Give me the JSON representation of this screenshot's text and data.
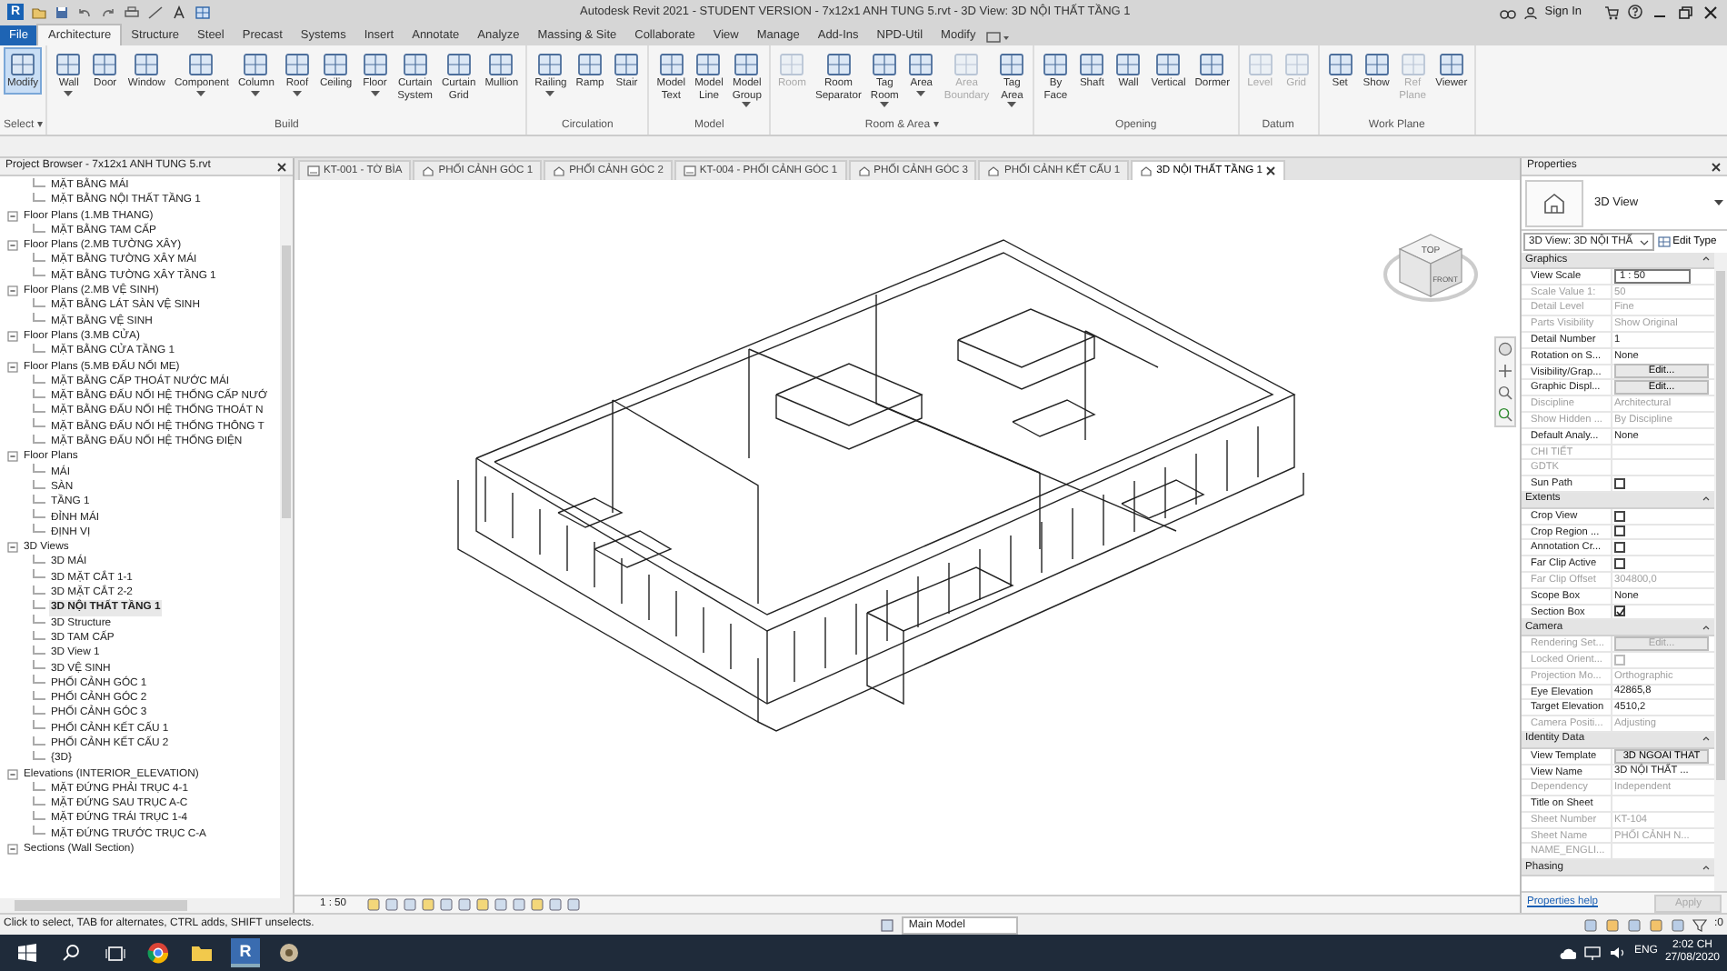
{
  "title_bar": {
    "logo": "R",
    "title": "Autodesk Revit 2021 - STUDENT VERSION - 7x12x1 ANH TUNG 5.rvt - 3D View: 3D NỘI THẤT TẦNG 1",
    "sign_in": "Sign In"
  },
  "ribbon_tabs": [
    {
      "label": "File",
      "kind": "file",
      "selected": false
    },
    {
      "label": "Architecture",
      "kind": "tab",
      "selected": true
    },
    {
      "label": "Structure",
      "kind": "tab",
      "selected": false
    },
    {
      "label": "Steel",
      "kind": "tab",
      "selected": false
    },
    {
      "label": "Precast",
      "kind": "tab",
      "selected": false
    },
    {
      "label": "Systems",
      "kind": "tab",
      "selected": false
    },
    {
      "label": "Insert",
      "kind": "tab",
      "selected": false
    },
    {
      "label": "Annotate",
      "kind": "tab",
      "selected": false
    },
    {
      "label": "Analyze",
      "kind": "tab",
      "selected": false
    },
    {
      "label": "Massing & Site",
      "kind": "tab",
      "selected": false
    },
    {
      "label": "Collaborate",
      "kind": "tab",
      "selected": false
    },
    {
      "label": "View",
      "kind": "tab",
      "selected": false
    },
    {
      "label": "Manage",
      "kind": "tab",
      "selected": false
    },
    {
      "label": "Add-Ins",
      "kind": "tab",
      "selected": false
    },
    {
      "label": "NPD-Util",
      "kind": "tab",
      "selected": false
    },
    {
      "label": "Modify",
      "kind": "tab",
      "selected": false
    }
  ],
  "ribbon_panels": [
    {
      "label": "Select ▾",
      "tools": [
        {
          "label": "Modify",
          "active": true,
          "disabled": false,
          "dropdown": false
        }
      ]
    },
    {
      "label": "Build",
      "tools": [
        {
          "label": "Wall",
          "active": false,
          "disabled": false,
          "dropdown": true
        },
        {
          "label": "Door",
          "active": false,
          "disabled": false,
          "dropdown": false
        },
        {
          "label": "Window",
          "active": false,
          "disabled": false,
          "dropdown": false
        },
        {
          "label": "Component",
          "active": false,
          "disabled": false,
          "dropdown": true
        },
        {
          "label": "Column",
          "active": false,
          "disabled": false,
          "dropdown": true
        },
        {
          "label": "Roof",
          "active": false,
          "disabled": false,
          "dropdown": true
        },
        {
          "label": "Ceiling",
          "active": false,
          "disabled": false,
          "dropdown": false
        },
        {
          "label": "Floor",
          "active": false,
          "disabled": false,
          "dropdown": true
        },
        {
          "label": "Curtain\nSystem",
          "active": false,
          "disabled": false,
          "dropdown": false
        },
        {
          "label": "Curtain\nGrid",
          "active": false,
          "disabled": false,
          "dropdown": false
        },
        {
          "label": "Mullion",
          "active": false,
          "disabled": false,
          "dropdown": false
        }
      ]
    },
    {
      "label": "Circulation",
      "tools": [
        {
          "label": "Railing",
          "active": false,
          "disabled": false,
          "dropdown": true
        },
        {
          "label": "Ramp",
          "active": false,
          "disabled": false,
          "dropdown": false
        },
        {
          "label": "Stair",
          "active": false,
          "disabled": false,
          "dropdown": false
        }
      ]
    },
    {
      "label": "Model",
      "tools": [
        {
          "label": "Model\nText",
          "active": false,
          "disabled": false,
          "dropdown": false
        },
        {
          "label": "Model\nLine",
          "active": false,
          "disabled": false,
          "dropdown": false
        },
        {
          "label": "Model\nGroup",
          "active": false,
          "disabled": false,
          "dropdown": true
        }
      ]
    },
    {
      "label": "Room & Area ▾",
      "tools": [
        {
          "label": "Room",
          "active": false,
          "disabled": true,
          "dropdown": false
        },
        {
          "label": "Room\nSeparator",
          "active": false,
          "disabled": false,
          "dropdown": false
        },
        {
          "label": "Tag\nRoom",
          "active": false,
          "disabled": false,
          "dropdown": true
        },
        {
          "label": "Area",
          "active": false,
          "disabled": false,
          "dropdown": true
        },
        {
          "label": "Area\nBoundary",
          "active": false,
          "disabled": true,
          "dropdown": false
        },
        {
          "label": "Tag\nArea",
          "active": false,
          "disabled": false,
          "dropdown": true
        }
      ]
    },
    {
      "label": "Opening",
      "tools": [
        {
          "label": "By\nFace",
          "active": false,
          "disabled": false,
          "dropdown": false
        },
        {
          "label": "Shaft",
          "active": false,
          "disabled": false,
          "dropdown": false
        },
        {
          "label": "Wall",
          "active": false,
          "disabled": false,
          "dropdown": false
        },
        {
          "label": "Vertical",
          "active": false,
          "disabled": false,
          "dropdown": false
        },
        {
          "label": "Dormer",
          "active": false,
          "disabled": false,
          "dropdown": false
        }
      ]
    },
    {
      "label": "Datum",
      "tools": [
        {
          "label": "Level",
          "active": false,
          "disabled": true,
          "dropdown": false
        },
        {
          "label": "Grid",
          "active": false,
          "disabled": true,
          "dropdown": false
        }
      ]
    },
    {
      "label": "Work Plane",
      "tools": [
        {
          "label": "Set",
          "active": false,
          "disabled": false,
          "dropdown": false
        },
        {
          "label": "Show",
          "active": false,
          "disabled": false,
          "dropdown": false
        },
        {
          "label": "Ref\nPlane",
          "active": false,
          "disabled": true,
          "dropdown": false
        },
        {
          "label": "Viewer",
          "active": false,
          "disabled": false,
          "dropdown": false
        }
      ]
    }
  ],
  "project_browser": {
    "title": "Project Browser - 7x12x1 ANH TUNG 5.rvt",
    "tree": [
      {
        "children": [
          {
            "label": "MẶT BẰNG MÁI",
            "selected": false
          },
          {
            "label": "MẶT BẰNG NỘI THẤT TẦNG 1",
            "selected": false
          }
        ]
      },
      {
        "label": "Floor Plans (1.MB THANG)",
        "expanded": true,
        "children": [
          {
            "label": "MẶT BẰNG TAM CẤP",
            "selected": false
          }
        ]
      },
      {
        "label": "Floor Plans (2.MB TƯỜNG XÂY)",
        "expanded": true,
        "children": [
          {
            "label": "MẶT BẰNG TƯỜNG XÂY MÁI",
            "selected": false
          },
          {
            "label": "MẶT BẰNG TƯỜNG XÂY TẦNG 1",
            "selected": false
          }
        ]
      },
      {
        "label": "Floor Plans (2.MB VỆ SINH)",
        "expanded": true,
        "children": [
          {
            "label": "MẶT BẰNG LÁT SÀN VỆ SINH",
            "selected": false
          },
          {
            "label": "MẶT BẰNG VỆ SINH",
            "selected": false
          }
        ]
      },
      {
        "label": "Floor Plans (3.MB CỬA)",
        "expanded": true,
        "children": [
          {
            "label": "MẶT BẰNG CỬA TẦNG 1",
            "selected": false
          }
        ]
      },
      {
        "label": "Floor Plans (5.MB ĐẤU NỐI ME)",
        "expanded": true,
        "children": [
          {
            "label": "MẶT BẰNG CẤP THOÁT NƯỚC MÁI",
            "selected": false
          },
          {
            "label": "MẶT BẰNG ĐẤU NỐI HỆ THỐNG CẤP NƯỚ",
            "selected": false
          },
          {
            "label": "MẶT BẰNG ĐẤU NỐI HỆ THỐNG THOÁT N",
            "selected": false
          },
          {
            "label": "MẶT BẰNG ĐẤU NỐI HỆ THỐNG THÔNG T",
            "selected": false
          },
          {
            "label": "MẶT BẰNG ĐẤU NỐI HỆ THỐNG ĐIỆN",
            "selected": false
          }
        ]
      },
      {
        "label": "Floor Plans",
        "expanded": true,
        "children": [
          {
            "label": "MÁI",
            "selected": false
          },
          {
            "label": "SÀN",
            "selected": false
          },
          {
            "label": "TẦNG 1",
            "selected": false
          },
          {
            "label": "ĐỈNH MÁI",
            "selected": false
          },
          {
            "label": "ĐỊNH VỊ",
            "selected": false
          }
        ]
      },
      {
        "label": "3D Views",
        "expanded": true,
        "children": [
          {
            "label": "3D MÁI",
            "selected": false
          },
          {
            "label": "3D MẶT CẮT 1-1",
            "selected": false
          },
          {
            "label": "3D MẶT CẮT 2-2",
            "selected": false
          },
          {
            "label": "3D NỘI THẤT TẦNG 1",
            "selected": true
          },
          {
            "label": "3D Structure",
            "selected": false
          },
          {
            "label": "3D TAM CẤP",
            "selected": false
          },
          {
            "label": "3D View 1",
            "selected": false
          },
          {
            "label": "3D VỆ SINH",
            "selected": false
          },
          {
            "label": "PHỐI CẢNH GÓC 1",
            "selected": false
          },
          {
            "label": "PHỐI CẢNH GÓC 2",
            "selected": false
          },
          {
            "label": "PHỐI CẢNH GÓC 3",
            "selected": false
          },
          {
            "label": "PHỐI CẢNH KẾT CẤU 1",
            "selected": false
          },
          {
            "label": "PHỐI CẢNH KẾT CẤU 2",
            "selected": false
          },
          {
            "label": "{3D}",
            "selected": false
          }
        ]
      },
      {
        "label": "Elevations (INTERIOR_ELEVATION)",
        "expanded": true,
        "children": [
          {
            "label": "MẶT ĐỨNG PHẢI TRỤC 4-1",
            "selected": false
          },
          {
            "label": "MẶT ĐỨNG SAU TRỤC A-C",
            "selected": false
          },
          {
            "label": "MẶT ĐỨNG TRÁI TRỤC 1-4",
            "selected": false
          },
          {
            "label": "MẶT ĐỨNG TRƯỚC TRỤC C-A",
            "selected": false
          }
        ]
      },
      {
        "label": "Sections (Wall Section)",
        "expanded": true
      }
    ]
  },
  "view_tabs": [
    {
      "label": "KT-001 - TỜ BÌA",
      "kind": "sheet",
      "selected": false
    },
    {
      "label": "PHỐI CẢNH GÓC 1",
      "kind": "model",
      "selected": false
    },
    {
      "label": "PHỐI CẢNH GÓC 2",
      "kind": "model",
      "selected": false
    },
    {
      "label": "KT-004 - PHỐI CẢNH GÓC 1",
      "kind": "sheet",
      "selected": false
    },
    {
      "label": "PHỐI CẢNH GÓC 3",
      "kind": "model",
      "selected": false
    },
    {
      "label": "PHỐI CẢNH KẾT CẤU 1",
      "kind": "model",
      "selected": false
    },
    {
      "label": "3D NỘI THẤT TẦNG 1",
      "kind": "model",
      "selected": true
    }
  ],
  "view_cube": {
    "top": "TOP",
    "front": "FRONT"
  },
  "view_scale": "1 : 50",
  "properties": {
    "title": "Properties",
    "type_name": "3D View",
    "selector": "3D View: 3D NỘI THẤ",
    "edit_type": "Edit Type",
    "sections": [
      {
        "label": "Graphics",
        "rows": [
          {
            "name": "View Scale",
            "value": "1 : 50",
            "kind": "field",
            "disabled": false
          },
          {
            "name": "Scale Value    1:",
            "value": "50",
            "kind": "text",
            "disabled": true
          },
          {
            "name": "Detail Level",
            "value": "Fine",
            "kind": "text",
            "disabled": true
          },
          {
            "name": "Parts Visibility",
            "value": "Show Original",
            "kind": "text",
            "disabled": true
          },
          {
            "name": "Detail Number",
            "value": "1",
            "kind": "text",
            "disabled": false
          },
          {
            "name": "Rotation on S...",
            "value": "None",
            "kind": "text",
            "disabled": false
          },
          {
            "name": "Visibility/Grap...",
            "value": "Edit...",
            "kind": "button",
            "disabled": false
          },
          {
            "name": "Graphic Displ...",
            "value": "Edit...",
            "kind": "button",
            "disabled": false
          },
          {
            "name": "Discipline",
            "value": "Architectural",
            "kind": "text",
            "disabled": true
          },
          {
            "name": "Show Hidden ...",
            "value": "By Discipline",
            "kind": "text",
            "disabled": true
          },
          {
            "name": "Default Analy...",
            "value": "None",
            "kind": "text",
            "disabled": false
          },
          {
            "name": "CHI TIẾT",
            "kind": "text",
            "disabled": true
          },
          {
            "name": "GDTK",
            "kind": "text",
            "disabled": true
          },
          {
            "name": "Sun Path",
            "kind": "check",
            "checked": false,
            "disabled": false
          }
        ]
      },
      {
        "label": "Extents",
        "rows": [
          {
            "name": "Crop View",
            "kind": "check",
            "checked": false,
            "disabled": false
          },
          {
            "name": "Crop Region ...",
            "kind": "check",
            "checked": false,
            "disabled": false
          },
          {
            "name": "Annotation Cr...",
            "kind": "check",
            "checked": false,
            "disabled": false
          },
          {
            "name": "Far Clip Active",
            "kind": "check",
            "checked": false,
            "disabled": false
          },
          {
            "name": "Far Clip Offset",
            "value": "304800,0",
            "kind": "text",
            "disabled": true
          },
          {
            "name": "Scope Box",
            "value": "None",
            "kind": "text",
            "disabled": false
          },
          {
            "name": "Section Box",
            "kind": "check",
            "checked": true,
            "disabled": false
          }
        ]
      },
      {
        "label": "Camera",
        "rows": [
          {
            "name": "Rendering Set...",
            "value": "Edit...",
            "kind": "button",
            "disabled": true
          },
          {
            "name": "Locked Orient...",
            "kind": "check",
            "checked": false,
            "disabled": true
          },
          {
            "name": "Projection Mo...",
            "value": "Orthographic",
            "kind": "text",
            "disabled": true
          },
          {
            "name": "Eye Elevation",
            "value": "42865,8",
            "kind": "text",
            "disabled": false
          },
          {
            "name": "Target Elevation",
            "value": "4510,2",
            "kind": "text",
            "disabled": false
          },
          {
            "name": "Camera Positi...",
            "value": "Adjusting",
            "kind": "text",
            "disabled": true
          }
        ]
      },
      {
        "label": "Identity Data",
        "rows": [
          {
            "name": "View Template",
            "value": "3D NGOAI THAT",
            "kind": "button",
            "disabled": false
          },
          {
            "name": "View Name",
            "value": "3D NỘI THẤT ...",
            "kind": "text",
            "disabled": false
          },
          {
            "name": "Dependency",
            "value": "Independent",
            "kind": "text",
            "disabled": true
          },
          {
            "name": "Title on Sheet",
            "kind": "text",
            "disabled": false
          },
          {
            "name": "Sheet Number",
            "value": "KT-104",
            "kind": "text",
            "disabled": true
          },
          {
            "name": "Sheet Name",
            "value": "PHỐI CẢNH N...",
            "kind": "text",
            "disabled": true
          },
          {
            "name": "NAME_ENGLI...",
            "kind": "text",
            "disabled": true
          }
        ]
      },
      {
        "label": "Phasing"
      }
    ],
    "help_link": "Properties help",
    "apply": "Apply",
    "apply_disabled": true
  },
  "status_bar": {
    "message": "Click to select, TAB for alternates, CTRL adds, SHIFT unselects.",
    "model": "Main Model",
    "filter": ":0"
  },
  "taskbar": {
    "revit": "R",
    "language": "ENG",
    "time": "2:02 CH",
    "date": "27/08/2020"
  }
}
